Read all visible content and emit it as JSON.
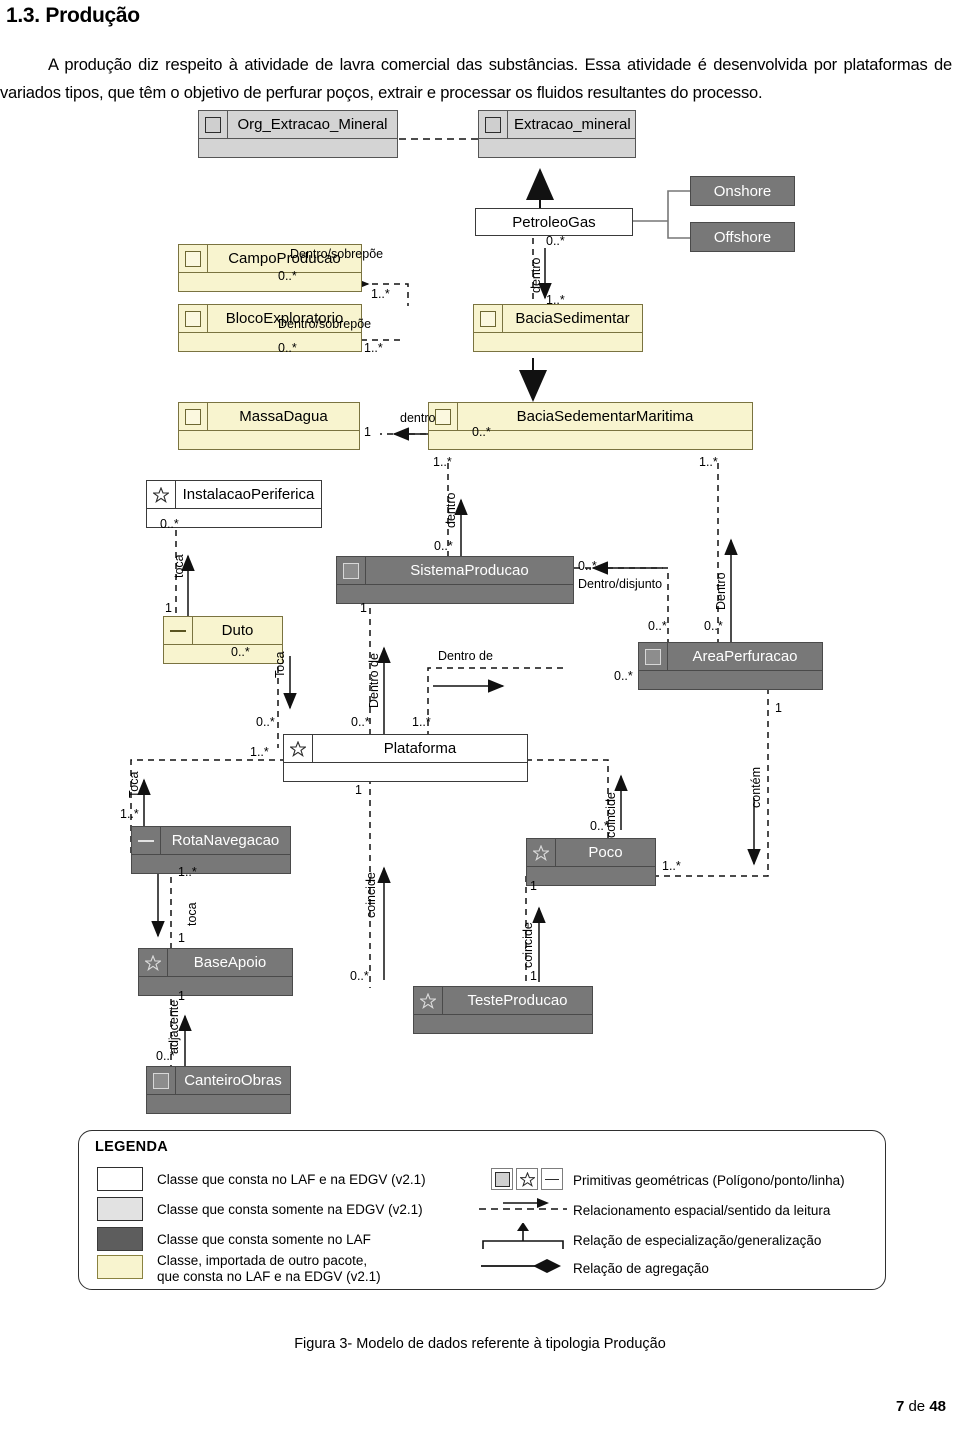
{
  "document": {
    "section_number": "1.3.",
    "section_title": "Produção",
    "paragraph": "A produção diz respeito à atividade de lavra comercial das substâncias. Essa atividade é desenvolvida por plataformas de variados tipos, que têm o objetivo de perfurar poços, extrair e processar os fluidos resultantes do processo.",
    "figure_caption": "Figura 3- Modelo de dados referente à tipologia Produção",
    "footer_page": "7",
    "footer_sep": "de",
    "footer_total": "48"
  },
  "colors": {
    "class_white": "#ffffff",
    "class_light_grey": "#d4d4d4",
    "class_dark_grey": "#787878",
    "class_yellow": "#f8f4cf",
    "stroke": "#3a3a3a"
  },
  "diagram": {
    "classes": [
      {
        "id": "org_extracao_mineral",
        "label": "Org_Extracao_Mineral",
        "fill": "light_grey",
        "primitive": "polygon"
      },
      {
        "id": "extracao_mineral",
        "label": "Extracao_mineral",
        "fill": "light_grey",
        "primitive": "polygon"
      },
      {
        "id": "petroleogas",
        "label": "PetroleoGas",
        "fill": "white",
        "primitive": "none"
      },
      {
        "id": "onshore",
        "label": "Onshore",
        "fill": "dark_grey",
        "primitive": "none"
      },
      {
        "id": "offshore",
        "label": "Offshore",
        "fill": "dark_grey",
        "primitive": "none"
      },
      {
        "id": "campoproducao",
        "label": "CampoProducao",
        "fill": "yellow",
        "primitive": "polygon"
      },
      {
        "id": "blocoexploratorio",
        "label": "BlocoExploratorio",
        "fill": "yellow",
        "primitive": "polygon"
      },
      {
        "id": "baciasedimentar",
        "label": "BaciaSedimentar",
        "fill": "yellow",
        "primitive": "polygon"
      },
      {
        "id": "massadagua",
        "label": "MassaDagua",
        "fill": "yellow",
        "primitive": "polygon"
      },
      {
        "id": "baciasedementarmaritima",
        "label": "BaciaSedementarMaritima",
        "fill": "yellow",
        "primitive": "polygon"
      },
      {
        "id": "instalacaoperiferica",
        "label": "InstalacaoPeriferica",
        "fill": "white",
        "primitive": "point"
      },
      {
        "id": "duto",
        "label": "Duto",
        "fill": "yellow",
        "primitive": "line"
      },
      {
        "id": "sistemaproducao",
        "label": "SistemaProducao",
        "fill": "dark_grey",
        "primitive": "polygon"
      },
      {
        "id": "areaperfuracao",
        "label": "AreaPerfuracao",
        "fill": "dark_grey",
        "primitive": "polygon"
      },
      {
        "id": "plataforma",
        "label": "Plataforma",
        "fill": "white",
        "primitive": "point"
      },
      {
        "id": "rotanavegacao",
        "label": "RotaNavegacao",
        "fill": "dark_grey",
        "primitive": "line"
      },
      {
        "id": "poco",
        "label": "Poco",
        "fill": "dark_grey",
        "primitive": "point"
      },
      {
        "id": "baseapoio",
        "label": "BaseApoio",
        "fill": "dark_grey",
        "primitive": "point"
      },
      {
        "id": "testeproducao",
        "label": "TesteProducao",
        "fill": "dark_grey",
        "primitive": "point"
      },
      {
        "id": "canteiroobras",
        "label": "CanteiroObras",
        "fill": "dark_grey",
        "primitive": "polygon"
      }
    ],
    "relations": [
      {
        "from": "extracao_mineral",
        "to": "org_extracao_mineral",
        "kind": "aggregation",
        "label": ""
      },
      {
        "from": "petroleogas",
        "to": "extracao_mineral",
        "kind": "generalization",
        "label": ""
      },
      {
        "from": "onshore",
        "to": "petroleogas",
        "kind": "generalization",
        "label": ""
      },
      {
        "from": "offshore",
        "to": "petroleogas",
        "kind": "generalization",
        "label": ""
      },
      {
        "from": "campoproducao",
        "to": "baciasedimentar",
        "kind": "spatial",
        "label": "Dentro/sobrepõe",
        "from_mult": "0..*",
        "to_mult": "1..*"
      },
      {
        "from": "blocoexploratorio",
        "to": "baciasedimentar",
        "kind": "spatial",
        "label": "Dentro/sobrepõe",
        "from_mult": "0..*",
        "to_mult": "1..*"
      },
      {
        "from": "petroleogas",
        "to": "baciasedimentar",
        "kind": "spatial",
        "label": "dentro",
        "from_mult": "0..*",
        "to_mult": "1..*"
      },
      {
        "from": "baciasedimentar",
        "to": "baciasedementarmaritima",
        "kind": "generalization",
        "label": ""
      },
      {
        "from": "baciasedementarmaritima",
        "to": "massadagua",
        "kind": "spatial",
        "label": "dentro",
        "from_mult": "0..*",
        "to_mult": "1"
      },
      {
        "from": "sistemaproducao",
        "to": "baciasedementarmaritima",
        "kind": "spatial",
        "label": "dentro",
        "from_mult": "0..*",
        "to_mult": "1..*"
      },
      {
        "from": "areaperfuracao",
        "to": "baciasedementarmaritima",
        "kind": "spatial",
        "label": "Dentro",
        "from_mult": "0..*",
        "to_mult": "1..*"
      },
      {
        "from": "areaperfuracao",
        "to": "sistemaproducao",
        "kind": "spatial",
        "label": "Dentro/disjunto",
        "from_mult": "0..*",
        "to_mult": "0..*"
      },
      {
        "from": "duto",
        "to": "instalacaoperiferica",
        "kind": "spatial",
        "label": "toca",
        "from_mult": "1",
        "to_mult": "0..*"
      },
      {
        "from": "duto",
        "to": "plataforma",
        "kind": "spatial",
        "label": "Toca",
        "from_mult": "0..*",
        "to_mult": "0..*"
      },
      {
        "from": "plataforma",
        "to": "sistemaproducao",
        "kind": "spatial",
        "label": "Dentro de",
        "from_mult": "0..*",
        "to_mult": "1"
      },
      {
        "from": "plataforma",
        "to": "areaperfuracao",
        "kind": "spatial",
        "label": "Dentro de",
        "from_mult": "1..*",
        "to_mult": "0..*"
      },
      {
        "from": "rotanavegacao",
        "to": "plataforma",
        "kind": "spatial",
        "label": "Toca",
        "from_mult": "1..*",
        "to_mult": "1..*"
      },
      {
        "from": "rotanavegacao",
        "to": "baseapoio",
        "kind": "spatial",
        "label": "toca",
        "from_mult": "1..*",
        "to_mult": "1"
      },
      {
        "from": "canteiroobras",
        "to": "baseapoio",
        "kind": "spatial",
        "label": "adjacente",
        "from_mult": "0..*",
        "to_mult": "1"
      },
      {
        "from": "testeproducao",
        "to": "plataforma",
        "kind": "spatial",
        "label": "coincide",
        "from_mult": "0..*",
        "to_mult": "1"
      },
      {
        "from": "testeproducao",
        "to": "poco",
        "kind": "spatial",
        "label": "coincide",
        "from_mult": "1",
        "to_mult": "1"
      },
      {
        "from": "poco",
        "to": "plataforma",
        "kind": "spatial",
        "label": "coincide",
        "from_mult": "0..*",
        "to_mult": "1"
      },
      {
        "from": "areaperfuracao",
        "to": "poco",
        "kind": "spatial",
        "label": "contém",
        "from_mult": "1",
        "to_mult": "1..*"
      }
    ],
    "multiplicities": {
      "zero_many": "0..*",
      "one_many": "1..*",
      "one": "1"
    },
    "role_labels": {
      "dentro_sobrepoe": "Dentro/sobrepõe",
      "dentro_lc": "dentro",
      "dentro_uc": "Dentro",
      "dentro_de": "Dentro de",
      "dentro_disjunto": "Dentro/disjunto",
      "toca_lc": "toca",
      "toca_uc": "Toca",
      "coincide": "coincide",
      "adjacente": "adjacente",
      "contem": "contém"
    }
  },
  "legend": {
    "title": "LEGENDA",
    "left_items": [
      {
        "swatch": "white",
        "text": "Classe que consta no LAF e na EDGV (v2.1)"
      },
      {
        "swatch": "ltgrey",
        "text": "Classe que consta somente na EDGV (v2.1)"
      },
      {
        "swatch": "dkgrey",
        "text": "Classe que consta somente no LAF"
      },
      {
        "swatch": "yellow",
        "text_line1": "Classe, importada de outro pacote,",
        "text_line2": "que consta no LAF e na EDGV (v2.1)"
      }
    ],
    "right_items": [
      {
        "symbol": "primitives",
        "text": "Primitivas geométricas (Polígono/ponto/linha)"
      },
      {
        "symbol": "dashed-arrow",
        "text": "Relacionamento espacial/sentido da leitura"
      },
      {
        "symbol": "generalization",
        "text": "Relação de especialização/generalização"
      },
      {
        "symbol": "aggregation",
        "text": "Relação de agregação"
      }
    ]
  }
}
